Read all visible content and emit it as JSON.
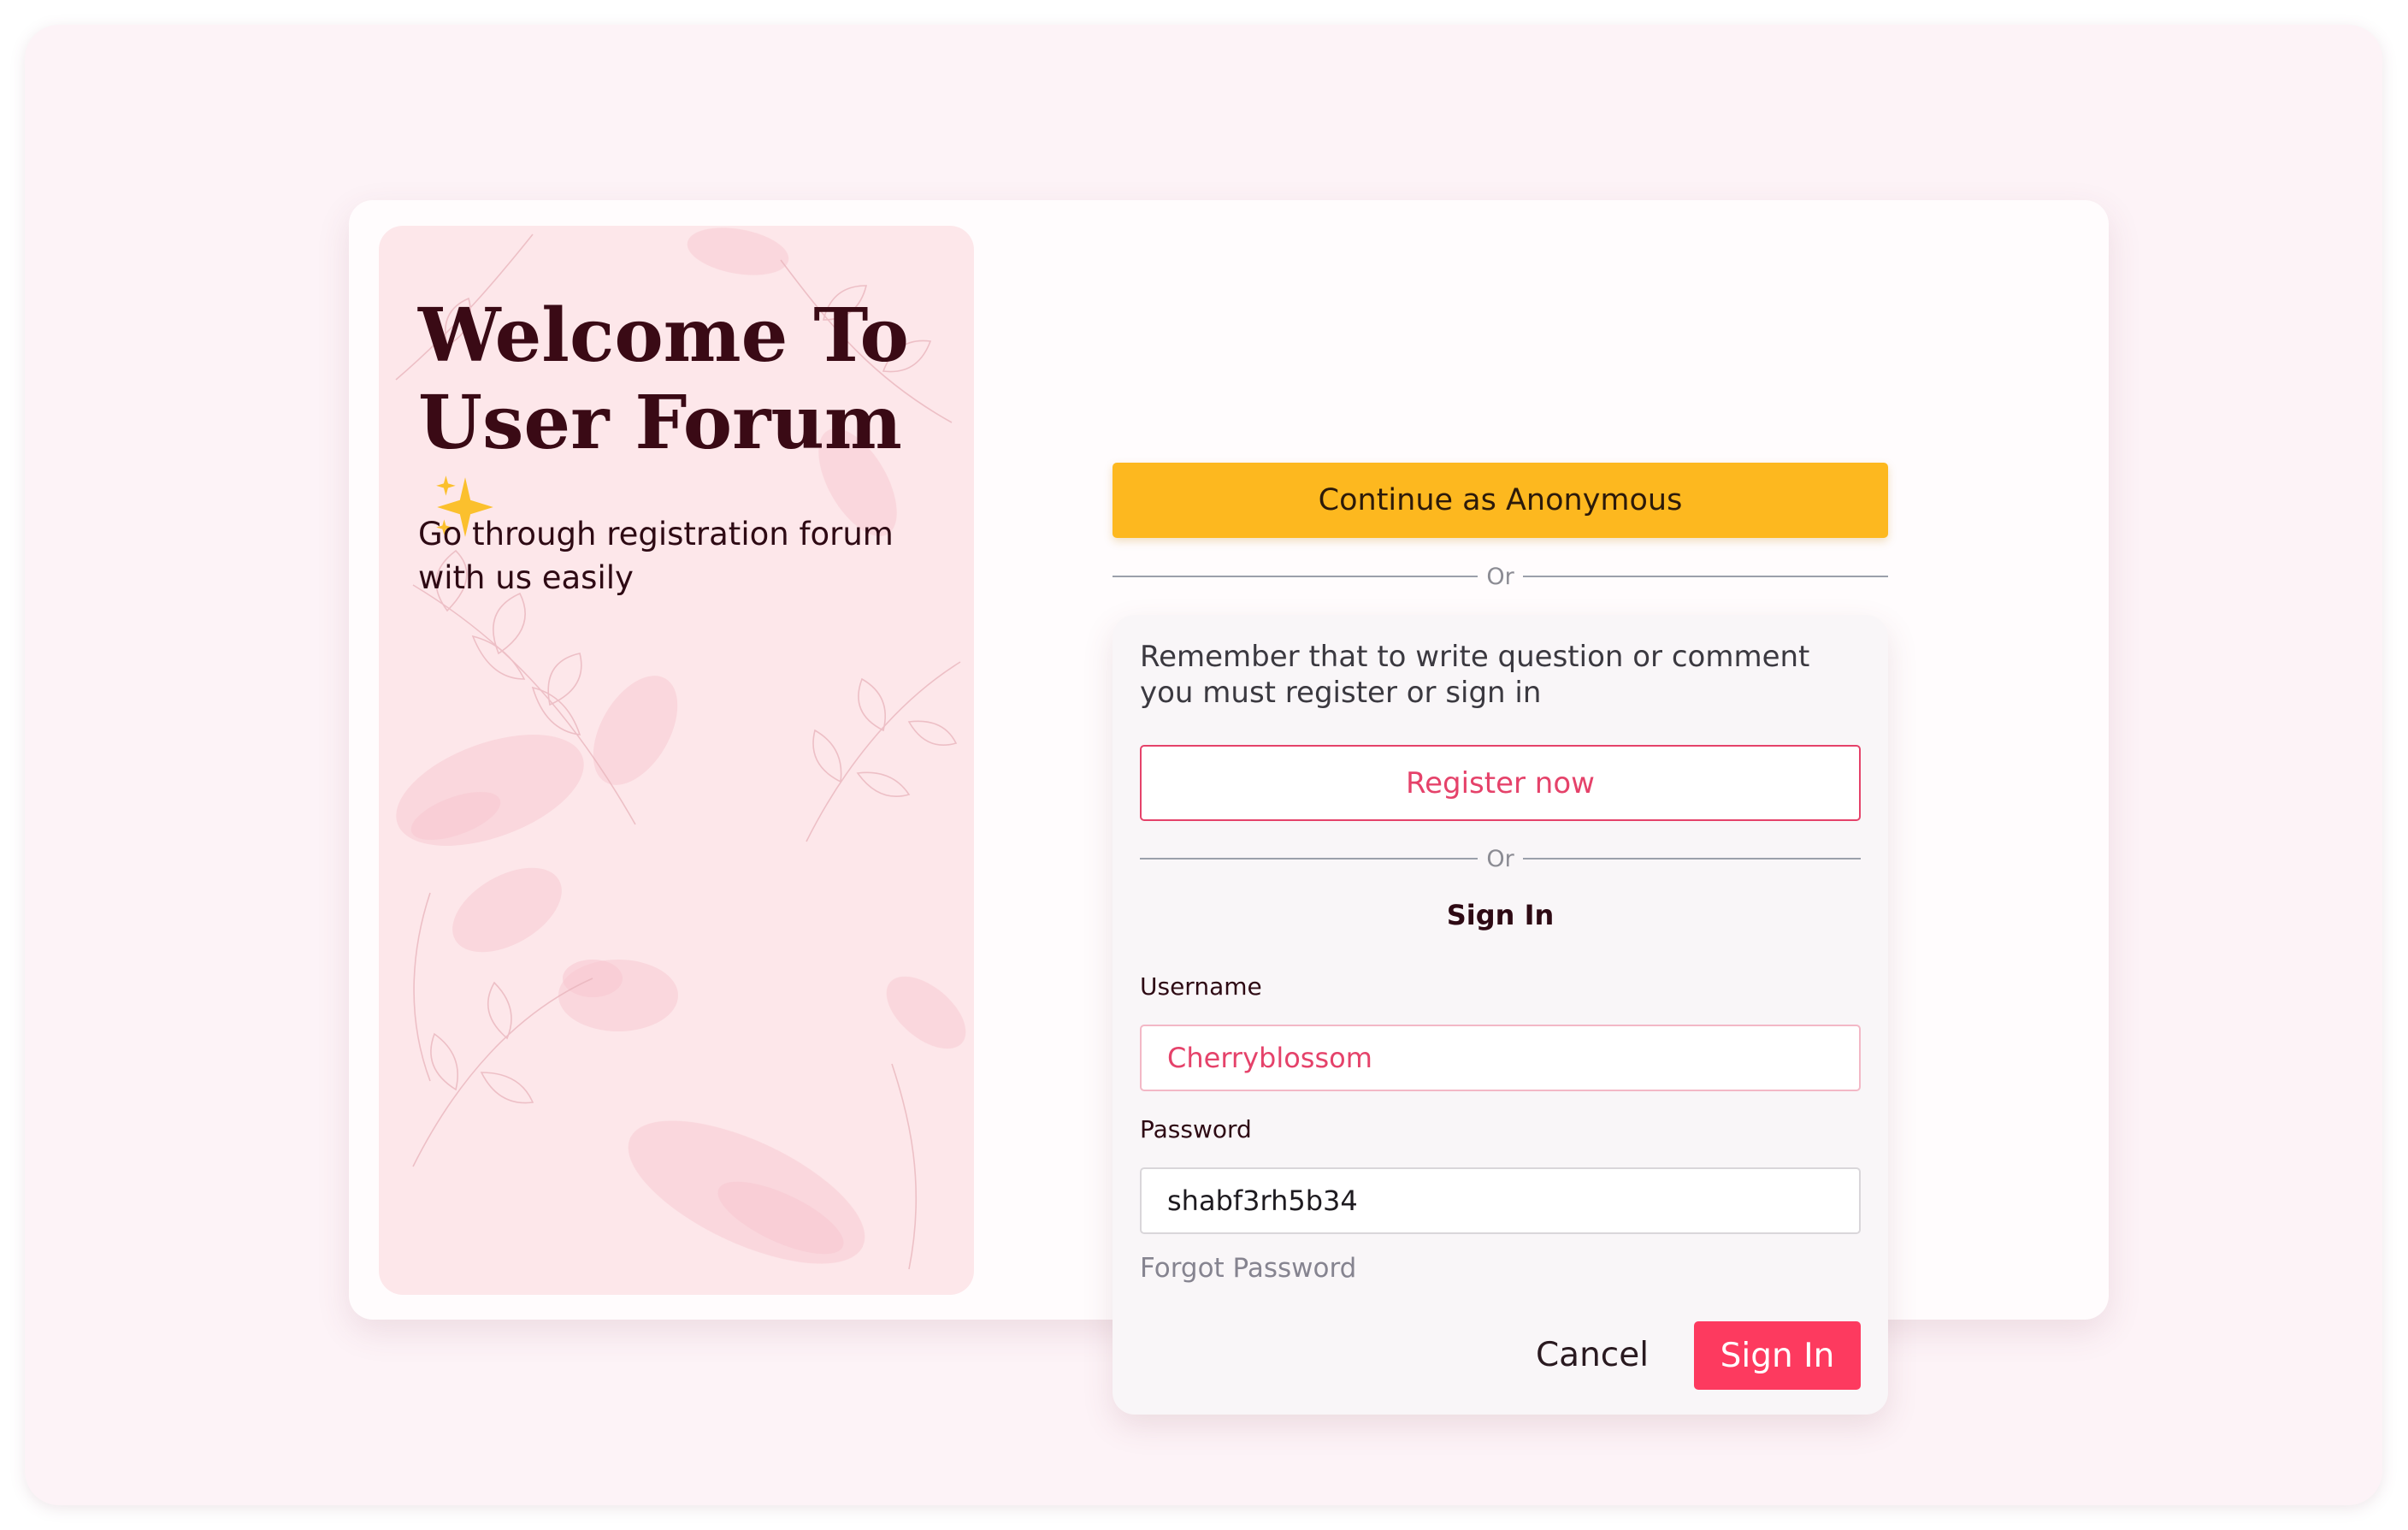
{
  "welcome_panel": {
    "title_line1": "Welcome To",
    "title_line2": "User Forum",
    "title_icon": "sparkles-icon",
    "subtitle": "Go through registration forum with us easily"
  },
  "anonymous": {
    "button_label": "Continue as Anonymous",
    "divider_text": "Or"
  },
  "signin_card": {
    "notice": "Remember that to write  question or comment you must register or sign in",
    "register_label": "Register now",
    "divider_text": "Or",
    "heading": "Sign In",
    "username_label": "Username",
    "username_value": "Cherryblossom",
    "password_label": "Password",
    "password_value": "shabf3rh5b34",
    "forgot_label": "Forgot Password",
    "cancel_label": "Cancel",
    "signin_label": "Sign In"
  },
  "colors": {
    "page_background": "#fdf3f7",
    "panel_background": "#fde7ea",
    "accent_yellow": "#fdb81f",
    "accent_pink": "#fd3a5f",
    "outline_pink": "#e5426a",
    "title_text": "#3a0a15"
  }
}
